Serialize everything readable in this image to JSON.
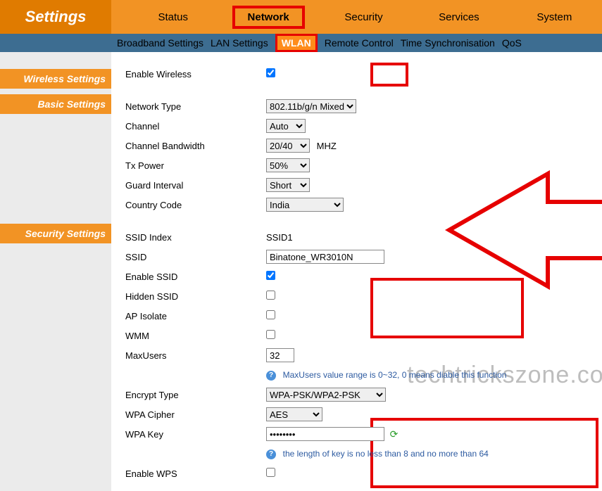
{
  "brand": "Settings",
  "mainnav": {
    "status": "Status",
    "network": "Network",
    "security": "Security",
    "services": "Services",
    "system": "System"
  },
  "subnav": {
    "broadband": "Broadband Settings",
    "lan": "LAN Settings",
    "wlan": "WLAN",
    "remote": "Remote Control",
    "timesync": "Time Synchronisation",
    "qos": "QoS"
  },
  "sidebar": {
    "wireless": "Wireless Settings",
    "basic": "Basic Settings",
    "security": "Security Settings"
  },
  "form": {
    "enable_wireless_label": "Enable Wireless",
    "network_type_label": "Network Type",
    "network_type_value": "802.11b/g/n Mixed",
    "channel_label": "Channel",
    "channel_value": "Auto",
    "bandwidth_label": "Channel Bandwidth",
    "bandwidth_value": "20/40",
    "bandwidth_unit": "MHZ",
    "txpower_label": "Tx Power",
    "txpower_value": "50%",
    "guard_label": "Guard Interval",
    "guard_value": "Short",
    "country_label": "Country Code",
    "country_value": "India",
    "ssid_index_label": "SSID Index",
    "ssid_index_value": "SSID1",
    "ssid_label": "SSID",
    "ssid_value": "Binatone_WR3010N",
    "enable_ssid_label": "Enable SSID",
    "hidden_ssid_label": "Hidden SSID",
    "ap_isolate_label": "AP Isolate",
    "wmm_label": "WMM",
    "maxusers_label": "MaxUsers",
    "maxusers_value": "32",
    "maxusers_help": "MaxUsers value range is 0~32, 0 means diable this function",
    "encrypt_label": "Encrypt Type",
    "encrypt_value": "WPA-PSK/WPA2-PSK",
    "wpa_cipher_label": "WPA Cipher",
    "wpa_cipher_value": "AES",
    "wpa_key_label": "WPA Key",
    "wpa_key_value": "••••••••",
    "wpa_key_help": "the length of key is no less than 8 and no more than 64",
    "enable_wps_label": "Enable WPS"
  },
  "watermark": "techtrickszone.com"
}
